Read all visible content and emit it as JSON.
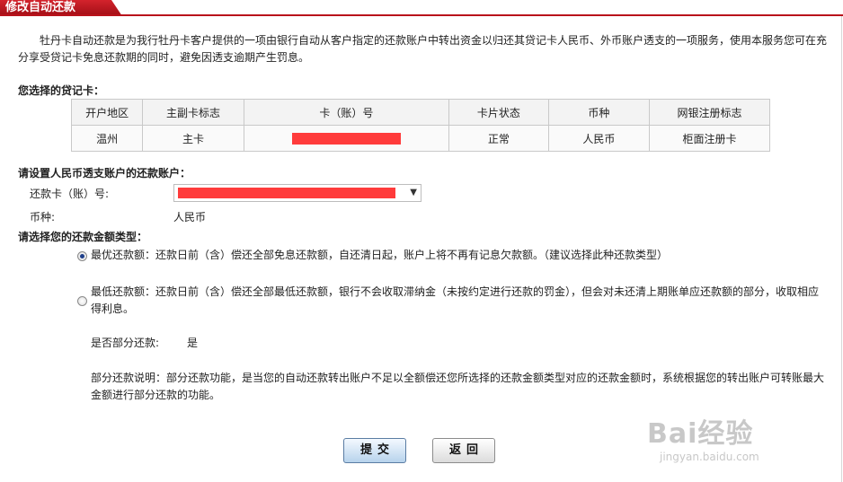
{
  "header": {
    "tab_title": "修改自动还款"
  },
  "intro": {
    "text": "牡丹卡自动还款是为我行牡丹卡客户提供的一项由银行自动从客户指定的还款账户中转出资金以归还其贷记卡人民币、外币账户透支的一项服务，使用本服务您可在充分享受贷记卡免息还款期的同时，避免因透支逾期产生罚息。"
  },
  "card_section": {
    "title": "您选择的贷记卡：",
    "columns": [
      "开户地区",
      "主副卡标志",
      "卡（账）号",
      "卡片状态",
      "币种",
      "网银注册标志"
    ],
    "row": {
      "region": "温州",
      "card_flag": "主卡",
      "card_no": "",
      "status": "正常",
      "currency": "人民币",
      "ebank_flag": "柜面注册卡"
    }
  },
  "account_section": {
    "title": "请设置人民币透支账户的还款账户：",
    "repay_card_label": "还款卡（账）号:",
    "currency_label": "币种:",
    "currency_value": "人民币"
  },
  "amount_section": {
    "title": "请选择您的还款金额类型：",
    "option1": "最优还款额：还款日前（含）偿还全部免息还款额，自还清日起，账户上将不再有记息欠款额。（建议选择此种还款类型）",
    "option2": "最低还款额：还款日前（含）偿还全部最低还款额，银行不会收取滞纳金（未按约定进行还款的罚金），但会对未还清上期账单应还款额的部分，收取相应得利息。",
    "selected": "option1",
    "partial_label": "是否部分还款:",
    "partial_value": "是",
    "partial_note": "部分还款说明：部分还款功能，是当您的自动还款转出账户不足以全额偿还您所选择的还款金额类型对应的还款金额时，系统根据您的转出账户可转账最大金额进行部分还款的功能。"
  },
  "buttons": {
    "submit": "提交",
    "back": "返回"
  },
  "watermark": {
    "brand": "Bai经验",
    "url": "jingyan.baidu.com"
  },
  "colors": {
    "accent": "#b9121b",
    "redaction": "#ff3b3b",
    "radio_selected": "#1f3f8a"
  }
}
